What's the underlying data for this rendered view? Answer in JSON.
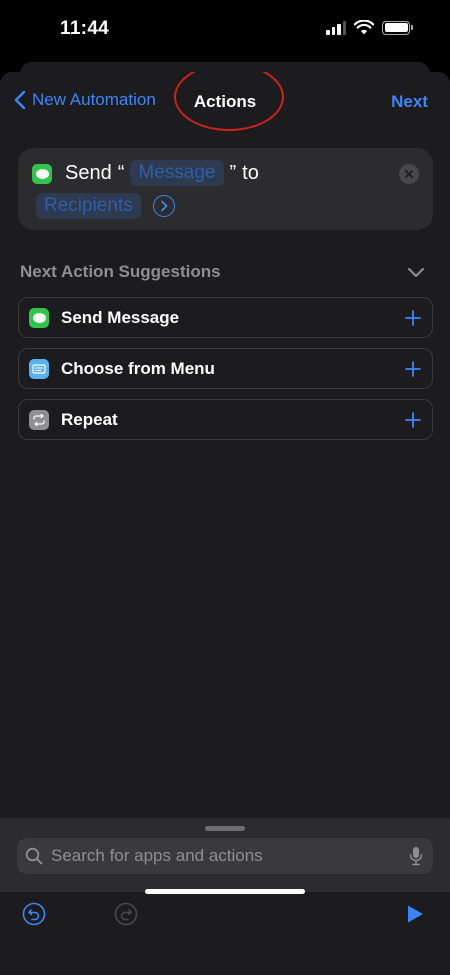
{
  "status": {
    "time": "11:44"
  },
  "nav": {
    "back_label": "New Automation",
    "title": "Actions",
    "next_label": "Next"
  },
  "action": {
    "verb": "Send",
    "open_quote": "“",
    "message_token": "Message",
    "close_quote": "”",
    "to": "to",
    "recipients_token": "Recipients"
  },
  "suggestions": {
    "header": "Next Action Suggestions",
    "items": [
      {
        "label": "Send Message",
        "icon": "messages-icon",
        "color": "#32c44d"
      },
      {
        "label": "Choose from Menu",
        "icon": "menu-icon",
        "color": "#5ab3f0"
      },
      {
        "label": "Repeat",
        "icon": "repeat-icon",
        "color": "#8e8e93"
      }
    ]
  },
  "search": {
    "placeholder": "Search for apps and actions"
  },
  "colors": {
    "accent": "#3b86f7",
    "annotation": "#d0201e"
  }
}
